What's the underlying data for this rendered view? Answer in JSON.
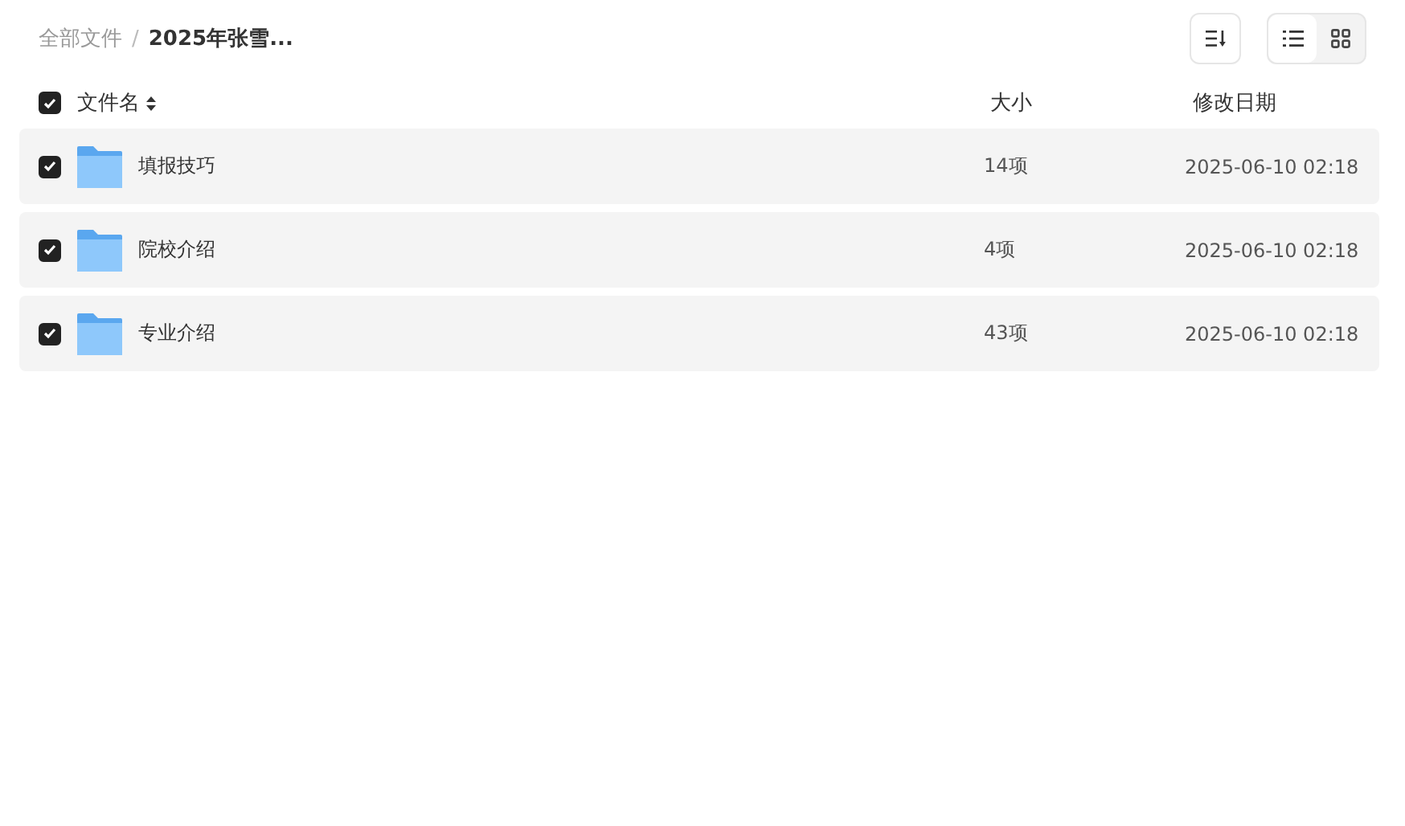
{
  "breadcrumb": [
    {
      "label": "全部文件",
      "current": false
    },
    {
      "label": "2025年张雪...",
      "current": true
    }
  ],
  "breadcrumb_separator": "/",
  "view_modes": [
    {
      "kind": "list",
      "selected": true
    },
    {
      "kind": "grid",
      "selected": false
    }
  ],
  "table": {
    "select_all_checked": true,
    "columns": [
      {
        "label": "文件名",
        "sortable": true
      },
      {
        "label": "大小",
        "sortable": false
      },
      {
        "label": "修改日期",
        "sortable": false
      }
    ],
    "rows": [
      {
        "checked": true,
        "name": "填报技巧",
        "size": "14项",
        "modified": "2025-06-10 02:18"
      },
      {
        "checked": true,
        "name": "院校介绍",
        "size": "4项",
        "modified": "2025-06-10 02:18"
      },
      {
        "checked": true,
        "name": "专业介绍",
        "size": "43项",
        "modified": "2025-06-10 02:18"
      }
    ]
  }
}
